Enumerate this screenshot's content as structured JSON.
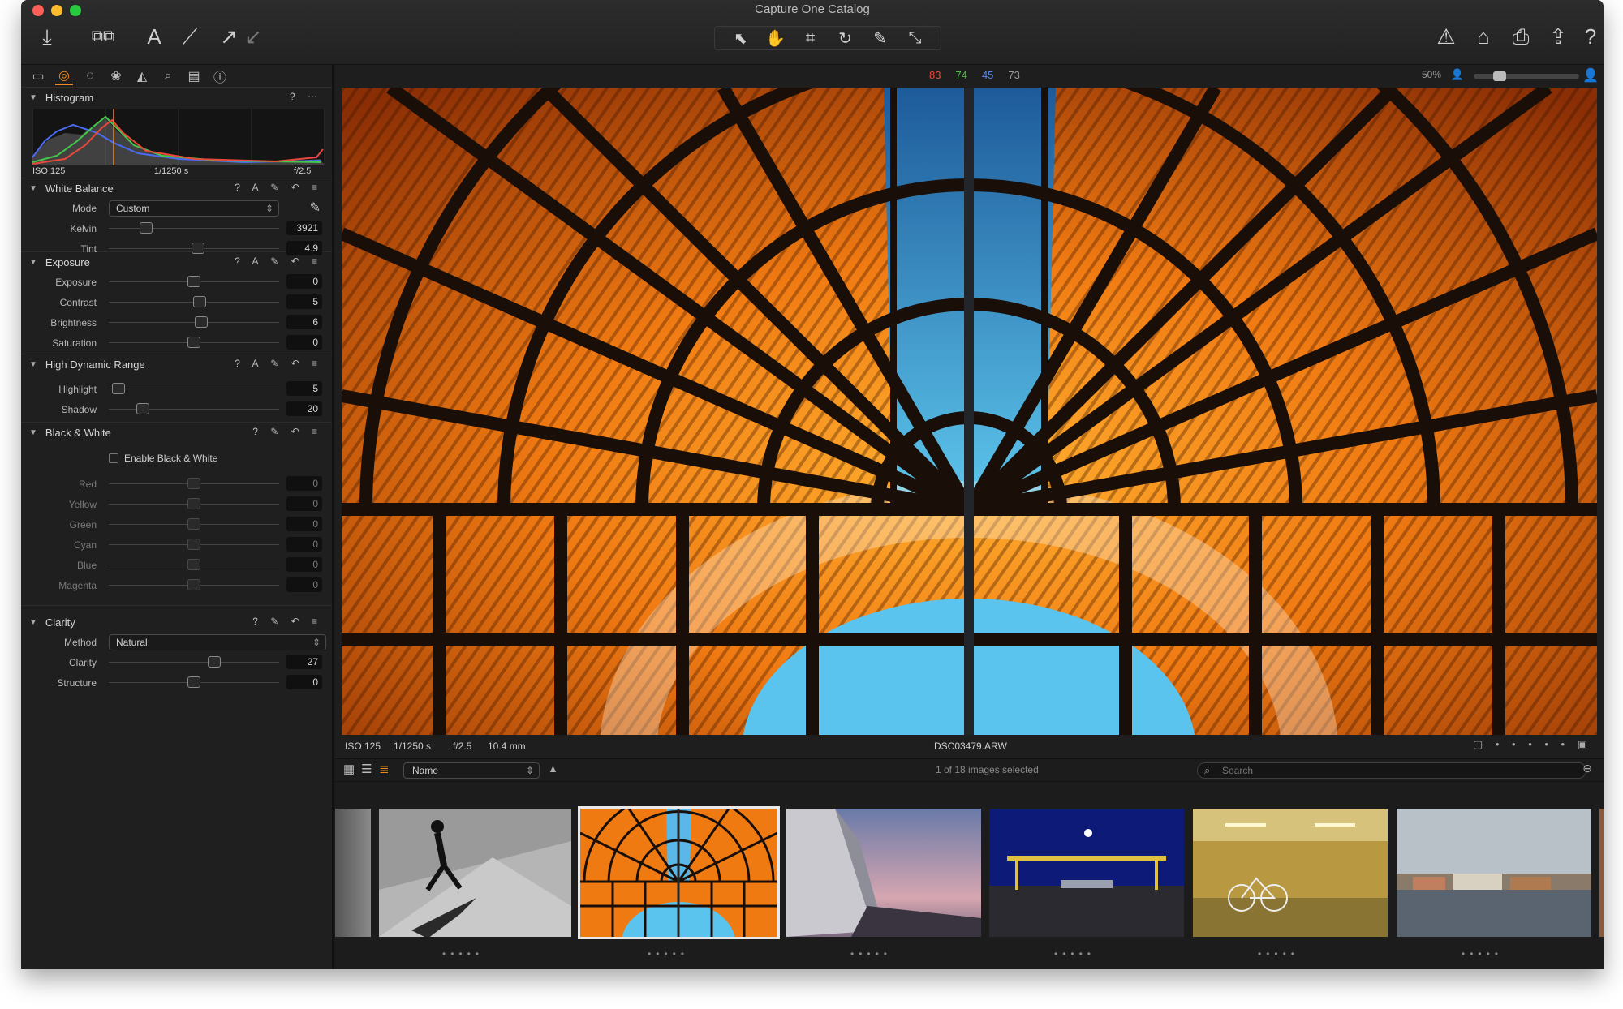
{
  "window": {
    "title": "Capture One Catalog"
  },
  "toolbar": {
    "left_icons": [
      "import-icon",
      "compare-icon",
      "text-tool-icon",
      "brush-icon",
      "redo-arrow-icon",
      "undo-arrow-icon"
    ],
    "cursor_tools": [
      "select-cursor-icon",
      "pan-hand-icon",
      "crop-icon",
      "rotate-icon",
      "picker-icon",
      "stamp-icon"
    ],
    "right_icons": [
      "warning-icon",
      "eraser-icon",
      "print-icon",
      "export-icon",
      "help-icon"
    ]
  },
  "tool_tabs": [
    "folder-icon",
    "capture-icon",
    "lens-icon",
    "color-icon",
    "exposure-icon",
    "search-icon",
    "details-icon",
    "info-icon"
  ],
  "histogram": {
    "title": "Histogram",
    "iso": "ISO 125",
    "shutter": "1/1250 s",
    "aperture": "f/2.5"
  },
  "white_balance": {
    "title": "White Balance",
    "mode_label": "Mode",
    "mode_value": "Custom",
    "kelvin_label": "Kelvin",
    "kelvin_value": "3921",
    "tint_label": "Tint",
    "tint_value": "4.9"
  },
  "exposure": {
    "title": "Exposure",
    "rows": [
      {
        "label": "Exposure",
        "value": "0"
      },
      {
        "label": "Contrast",
        "value": "5"
      },
      {
        "label": "Brightness",
        "value": "6"
      },
      {
        "label": "Saturation",
        "value": "0"
      }
    ]
  },
  "hdr": {
    "title": "High Dynamic Range",
    "rows": [
      {
        "label": "Highlight",
        "value": "5"
      },
      {
        "label": "Shadow",
        "value": "20"
      }
    ]
  },
  "black_white": {
    "title": "Black & White",
    "enable_label": "Enable Black & White",
    "rows": [
      {
        "label": "Red",
        "value": "0"
      },
      {
        "label": "Yellow",
        "value": "0"
      },
      {
        "label": "Green",
        "value": "0"
      },
      {
        "label": "Cyan",
        "value": "0"
      },
      {
        "label": "Blue",
        "value": "0"
      },
      {
        "label": "Magenta",
        "value": "0"
      }
    ]
  },
  "clarity": {
    "title": "Clarity",
    "method_label": "Method",
    "method_value": "Natural",
    "clarity_label": "Clarity",
    "clarity_value": "27",
    "structure_label": "Structure",
    "structure_value": "0"
  },
  "viewer": {
    "rgb": {
      "r": "83",
      "g": "74",
      "b": "45",
      "l": "73"
    },
    "colors": {
      "r": "#e84a3a",
      "g": "#55c04a",
      "b": "#5a86e6",
      "l": "#9a9a9a"
    },
    "zoom": "50%",
    "iso": "ISO 125",
    "shutter": "1/1250 s",
    "aperture": "f/2.5",
    "focal": "10.4 mm",
    "filename": "DSC03479.ARW"
  },
  "browser": {
    "sort_label": "Name",
    "selection_text": "1 of 18 images selected",
    "search_placeholder": "Search"
  },
  "accent_color": "#f08a1e"
}
